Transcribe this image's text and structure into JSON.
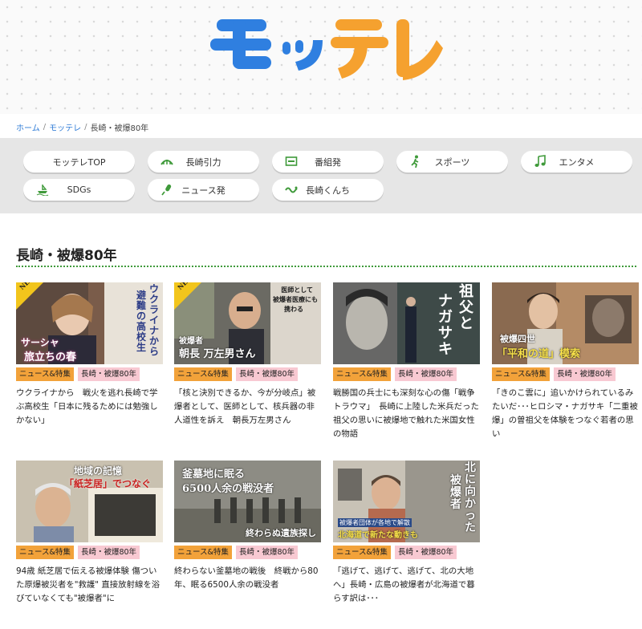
{
  "logo": {
    "text": "モッテレ",
    "colors": {
      "blue": "#2f7fe0",
      "orange": "#f5a12f"
    }
  },
  "breadcrumb": {
    "home": "ホーム",
    "sep1": "/",
    "mottele": "モッテレ",
    "sep2": "/",
    "current": "長崎・被爆80年"
  },
  "nav": {
    "items": [
      {
        "label": "モッテレTOP",
        "icon": "none"
      },
      {
        "label": "長崎引力",
        "icon": "bridge-icon"
      },
      {
        "label": "番組発",
        "icon": "tv-icon"
      },
      {
        "label": "スポーツ",
        "icon": "runner-icon"
      },
      {
        "label": "エンタメ",
        "icon": "music-note-icon"
      },
      {
        "label": "SDGs",
        "icon": "ship-icon"
      },
      {
        "label": "ニュース発",
        "icon": "microphone-icon"
      },
      {
        "label": "長崎くんち",
        "icon": "dragon-icon"
      }
    ],
    "accent": "#3f9a3a"
  },
  "section": {
    "title": "長崎・被爆80年"
  },
  "tags": {
    "news": "ニュース&特集",
    "series": "長崎・被爆80年"
  },
  "articles": [
    {
      "badge": "NEW",
      "thumb_text_1": "ウクライナから",
      "thumb_text_2": "避難の高校生",
      "thumb_text_3": "サーシャ",
      "thumb_text_4": "旅立ちの春",
      "desc": "ウクライナから　戦火を逃れ長崎で学ぶ高校生「日本に残るためには勉強しかない」"
    },
    {
      "badge": "NEW",
      "thumb_text_1": "被爆者",
      "thumb_text_2": "朝長 万左男さん",
      "thumb_text_3": "医師として",
      "thumb_text_4": "被爆者医療にも",
      "thumb_text_5": "携わる",
      "desc": "「核と決別できるか、今が分岐点」被爆者として、医師として、核兵器の非人道性を訴え　朝長万左男さん"
    },
    {
      "thumb_text_1": "祖父と",
      "thumb_text_2": "ナガサキ",
      "desc": "戦勝国の兵士にも深刻な心の傷「戦争トラウマ」　長崎に上陸した米兵だった祖父の思いに被爆地で触れた米国女性の物語"
    },
    {
      "thumb_text_1": "被爆四世",
      "thumb_text_2": "「平和の道」模索",
      "desc": "「きのこ雲に」追いかけられているみたいだ･･･ヒロシマ・ナガサキ「二重被爆」の曽祖父を体験をつなぐ若者の思い"
    },
    {
      "thumb_text_1": "地域の記憶",
      "thumb_text_2": "「紙芝居」でつなぐ",
      "desc": "94歳 紙芝居で伝える被爆体験 傷ついた原爆被災者を\"救護\" 直接放射線を浴びていなくても\"被爆者\"に"
    },
    {
      "thumb_text_1": "釜墓地に眠る",
      "thumb_text_2": "6500人余の戦没者",
      "thumb_text_3": "終わらぬ遺族探し",
      "desc": "終わらない釜墓地の戦後　終戦から80年、眠る6500人余の戦没者"
    },
    {
      "thumb_text_1": "北に向かった",
      "thumb_text_2": "被爆者",
      "thumb_text_3": "被爆者団体が各地で解散",
      "thumb_text_4": "北海道で新たな動きも",
      "desc": "「逃げて、逃げて、逃げて、北の大地へ」長崎・広島の被爆者が北海道で暮らす訳は･･･"
    }
  ]
}
